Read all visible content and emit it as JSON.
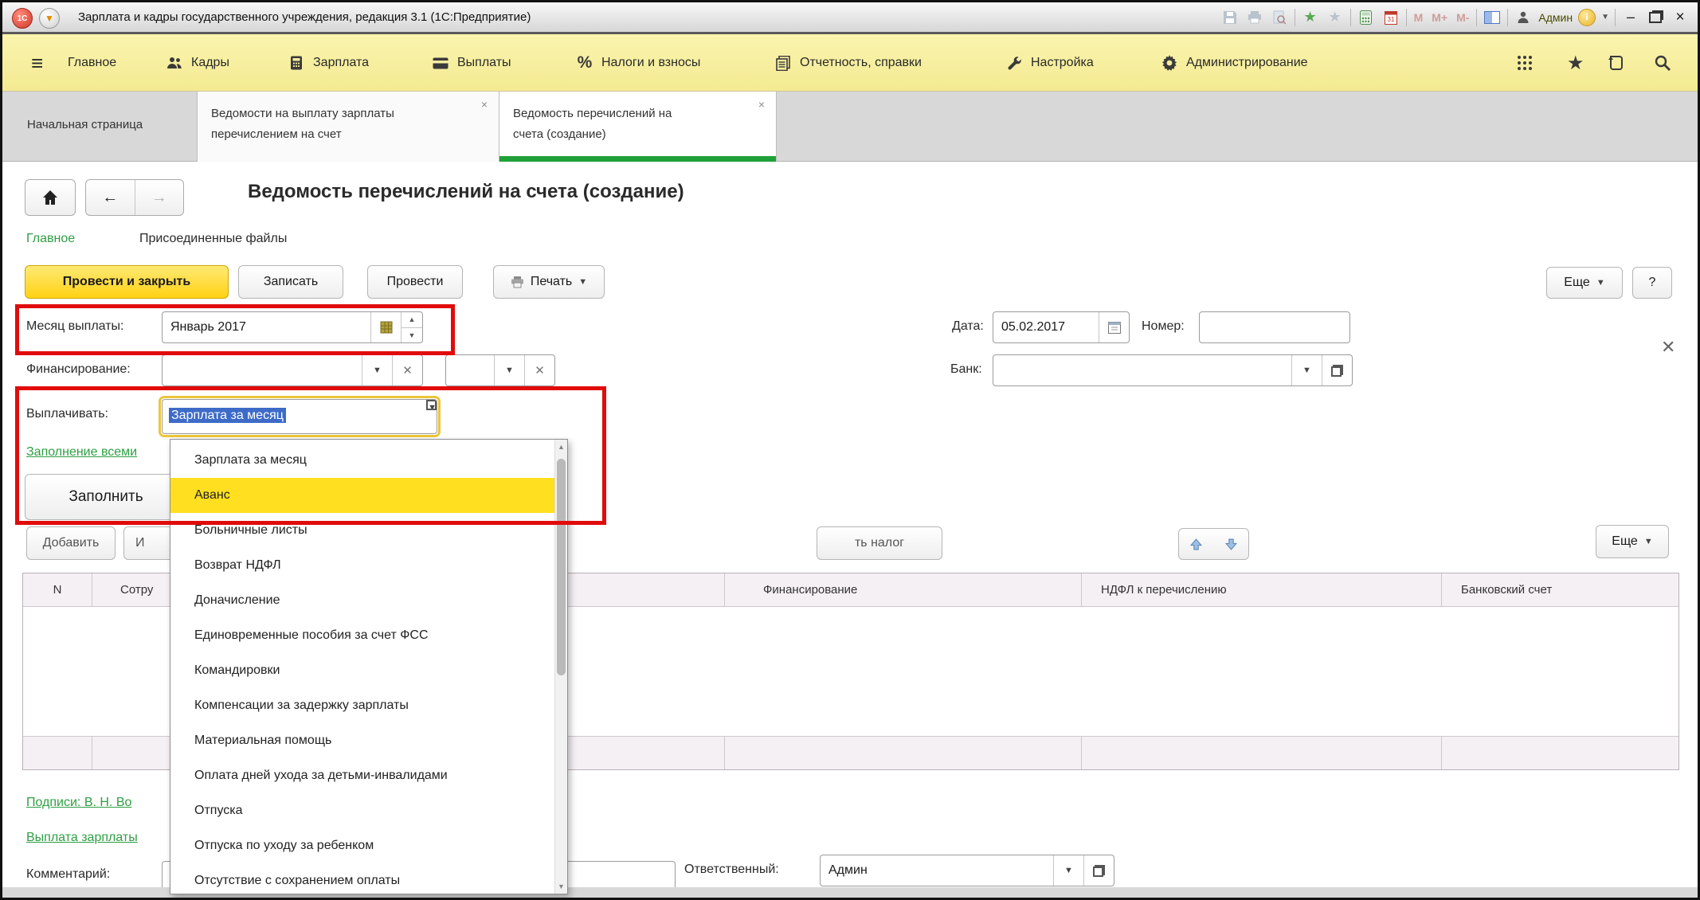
{
  "titlebar": {
    "app_title": "Зарплата и кадры государственного учреждения, редакция 3.1  (1С:Предприятие)",
    "logo": "1С",
    "user": "Админ",
    "memory_buttons": [
      "M",
      "M+",
      "M-"
    ]
  },
  "menubar": {
    "items": [
      {
        "label": "Главное"
      },
      {
        "label": "Кадры"
      },
      {
        "label": "Зарплата"
      },
      {
        "label": "Выплаты"
      },
      {
        "label": "Налоги и взносы"
      },
      {
        "label": "Отчетность, справки"
      },
      {
        "label": "Настройка"
      },
      {
        "label": "Администрирование"
      }
    ]
  },
  "tabs": [
    {
      "label": "Начальная страница"
    },
    {
      "label_line1": "Ведомости на выплату зарплаты",
      "label_line2": "перечислением на счет",
      "close": "×"
    },
    {
      "label_line1": "Ведомость перечислений на",
      "label_line2": "счета (создание)",
      "close": "×"
    }
  ],
  "form": {
    "title": "Ведомость перечислений на счета (создание)",
    "nav": {
      "main": "Главное",
      "attachments": "Присоединенные файлы"
    },
    "toolbar": {
      "submit": "Провести и закрыть",
      "save": "Записать",
      "post": "Провести",
      "print": "Печать",
      "more": "Еще",
      "help": "?"
    },
    "fields": {
      "month": {
        "label": "Месяц выплаты:",
        "value": "Январь 2017"
      },
      "financing": {
        "label": "Финансирование:",
        "value": ""
      },
      "date": {
        "label": "Дата:",
        "value": "05.02.2017"
      },
      "number": {
        "label": "Номер:",
        "value": ""
      },
      "bank": {
        "label": "Банк:",
        "value": ""
      },
      "pay": {
        "label": "Выплачивать:",
        "value": "Зарплата за месяц"
      },
      "comment": {
        "label": "Комментарий:",
        "value": ""
      },
      "responsible": {
        "label": "Ответственный:",
        "value": "Админ"
      }
    },
    "fill_link": "Заполнение всеми",
    "fill_button": "Заполнить",
    "table_toolbar": {
      "add": "Добавить",
      "partial_button": "И",
      "tax_partial": "ть налог",
      "more": "Еще"
    },
    "table": {
      "columns": [
        "N",
        "Сотру",
        "Финансирование",
        "НДФЛ к перечислению",
        "Банковский счет"
      ]
    },
    "links": {
      "signatures": "Подписи: В. Н. Во",
      "payroll": "Выплата зарплаты "
    }
  },
  "dropdown": {
    "selected": "Аванс",
    "items": [
      "Зарплата за месяц",
      "Аванс",
      "Больничные листы",
      "Возврат НДФЛ",
      "Доначисление",
      "Единовременные пособия за счет ФСС",
      "Командировки",
      "Компенсации за задержку зарплаты",
      "Материальная помощь",
      "Оплата дней ухода за детьми-инвалидами",
      "Отпуска",
      "Отпуска по уходу за ребенком",
      "Отсутствие с сохранением оплаты"
    ]
  },
  "colors": {
    "accent_green": "#21a038",
    "menu_yellow": "#f7efa0",
    "highlight_yellow": "#ffdf1f",
    "annotation_red": "#e10b0b",
    "selection_blue": "#3d6bc7",
    "primary_button_yellow": "#ffd215"
  }
}
